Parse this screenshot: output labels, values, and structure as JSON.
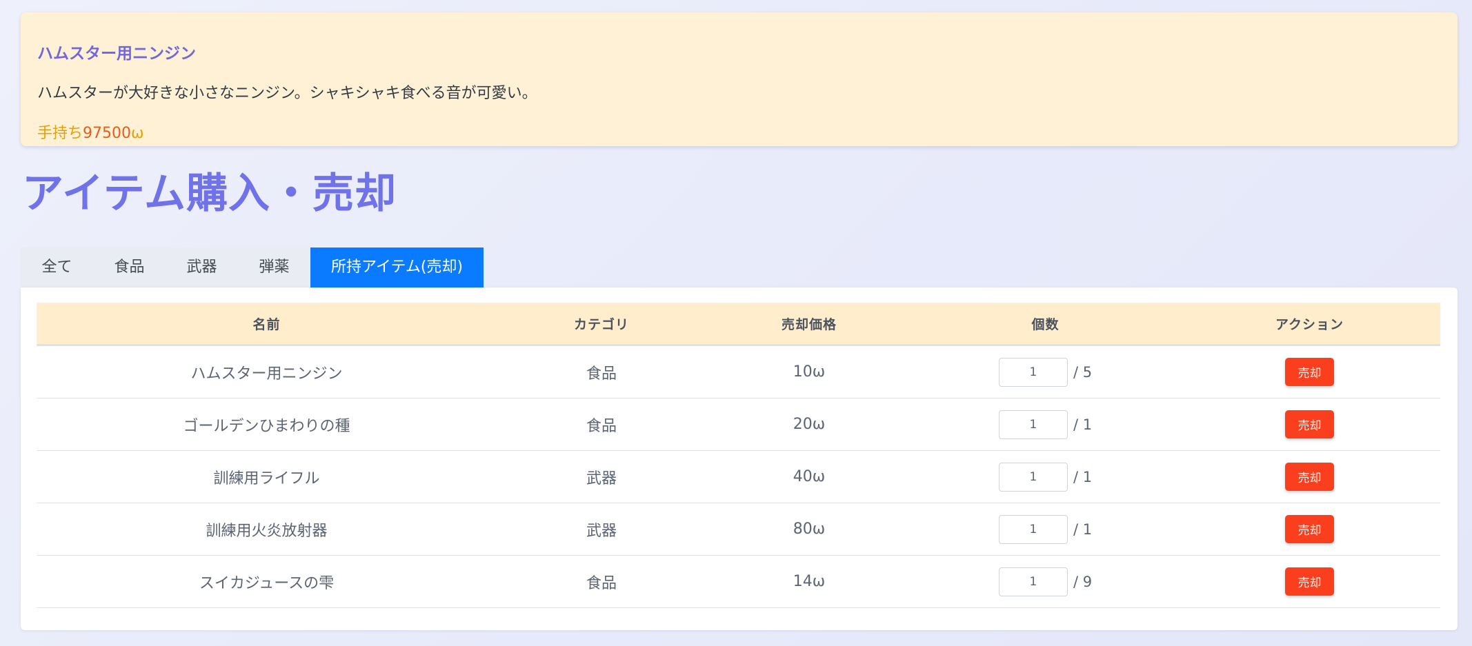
{
  "info": {
    "title": "ハムスター用ニンジン",
    "description": "ハムスターが大好きな小さなニンジン。シャキシャキ食べる音が可愛い。",
    "money_label": "手持ち",
    "money_amount": "97500",
    "money_unit": "ω"
  },
  "page": {
    "title": "アイテム購入・売却"
  },
  "tabs": [
    {
      "label": "全て"
    },
    {
      "label": "食品"
    },
    {
      "label": "武器"
    },
    {
      "label": "弾薬"
    },
    {
      "label": "所持アイテム(売却)",
      "active": true
    }
  ],
  "table": {
    "headers": [
      "名前",
      "カテゴリ",
      "売却価格",
      "個数",
      "アクション"
    ],
    "rows": [
      {
        "name": "ハムスター用ニンジン",
        "category": "食品",
        "price": "10ω",
        "qty": "1",
        "max": "/ 5",
        "action": "売却"
      },
      {
        "name": "ゴールデンひまわりの種",
        "category": "食品",
        "price": "20ω",
        "qty": "1",
        "max": "/ 1",
        "action": "売却"
      },
      {
        "name": "訓練用ライフル",
        "category": "武器",
        "price": "40ω",
        "qty": "1",
        "max": "/ 1",
        "action": "売却"
      },
      {
        "name": "訓練用火炎放射器",
        "category": "武器",
        "price": "80ω",
        "qty": "1",
        "max": "/ 1",
        "action": "売却"
      },
      {
        "name": "スイカジュースの雫",
        "category": "食品",
        "price": "14ω",
        "qty": "1",
        "max": "/ 9",
        "action": "売却"
      }
    ]
  },
  "colors": {
    "accent": "#6f72e8",
    "tab_active": "#0a7bff",
    "sell_button": "#fa3f1e",
    "info_bg": "#fff1d6",
    "header_bg": "#ffedcc"
  }
}
